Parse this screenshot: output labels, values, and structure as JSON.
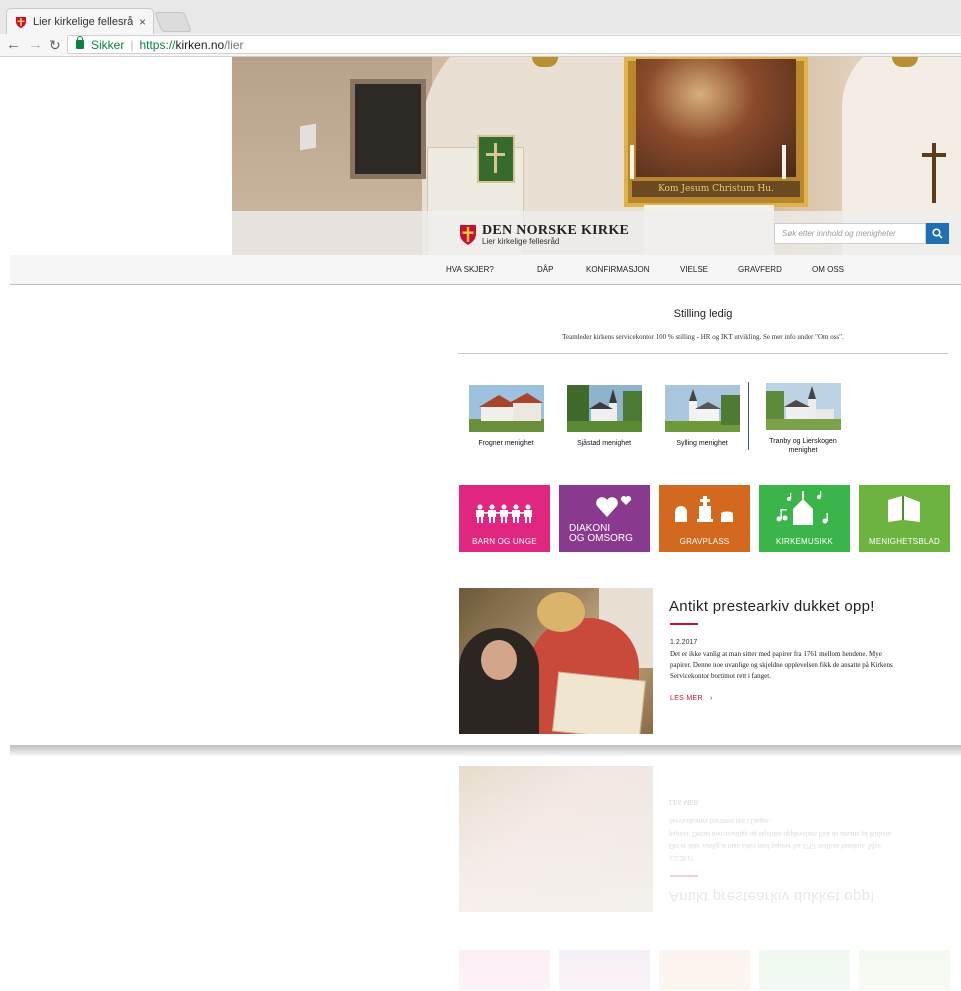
{
  "browser": {
    "tab_title": "Lier kirkelige fellesråd - L",
    "tab_close": "×",
    "url_secure": "Sikker",
    "url_protocol": "https://",
    "url_host": "kirken.no",
    "url_path": "/lier"
  },
  "header": {
    "logo_title": "DEN NORSKE KIRKE",
    "logo_subtitle": "Lier kirkelige fellesråd",
    "search_placeholder": "Søk etter innhold og menigheter",
    "painting_inscription": "Kom Jesum Christum Hu."
  },
  "nav": {
    "items": [
      "HVA SKJER?",
      "DÅP",
      "KONFIRMASJON",
      "VIELSE",
      "GRAVFERD",
      "OM OSS"
    ]
  },
  "notice": {
    "title": "Stilling ledig",
    "text": "Teamleder kirkens servicekontor 100 % stilling - HR og IKT utvikling. Se mer info under \"Om oss\"."
  },
  "parishes": [
    {
      "label": "Frogner menighet"
    },
    {
      "label": "Sjåstad menighet"
    },
    {
      "label": "Sylling menighet"
    },
    {
      "label": "Tranby og Lierskogen menighet"
    }
  ],
  "tiles": [
    {
      "label": "BARN OG UNGE",
      "color": "#e0267f"
    },
    {
      "label_line1": "DIAKONI",
      "label_line2": "OG OMSORG",
      "color": "#8a3a8e"
    },
    {
      "label": "GRAVPLASS",
      "color": "#d2691e"
    },
    {
      "label": "KIRKEMUSIKK",
      "color": "#3bb54a"
    },
    {
      "label": "MENIGHETSBLAD",
      "color": "#6cb33f"
    }
  ],
  "news": {
    "title": "Antikt prestearkiv dukket opp!",
    "date": "1.2.2017",
    "body_line1": "Det er ikke vanlig at man sitter med papirer fra 1761 mellom hendene. Mye",
    "body_line2": "papirer. Denne noe uvanlige og skjeldne opplevelsen fikk de ansatte på Kirkens",
    "body_line3": "Servicekontor bortimot rett i fanget.",
    "read_more": "LES MER",
    "read_more_icon": "›"
  },
  "colors": {
    "accent_red": "#c8102e",
    "search_blue": "#1f6fb2",
    "secure_green": "#0b8043"
  }
}
